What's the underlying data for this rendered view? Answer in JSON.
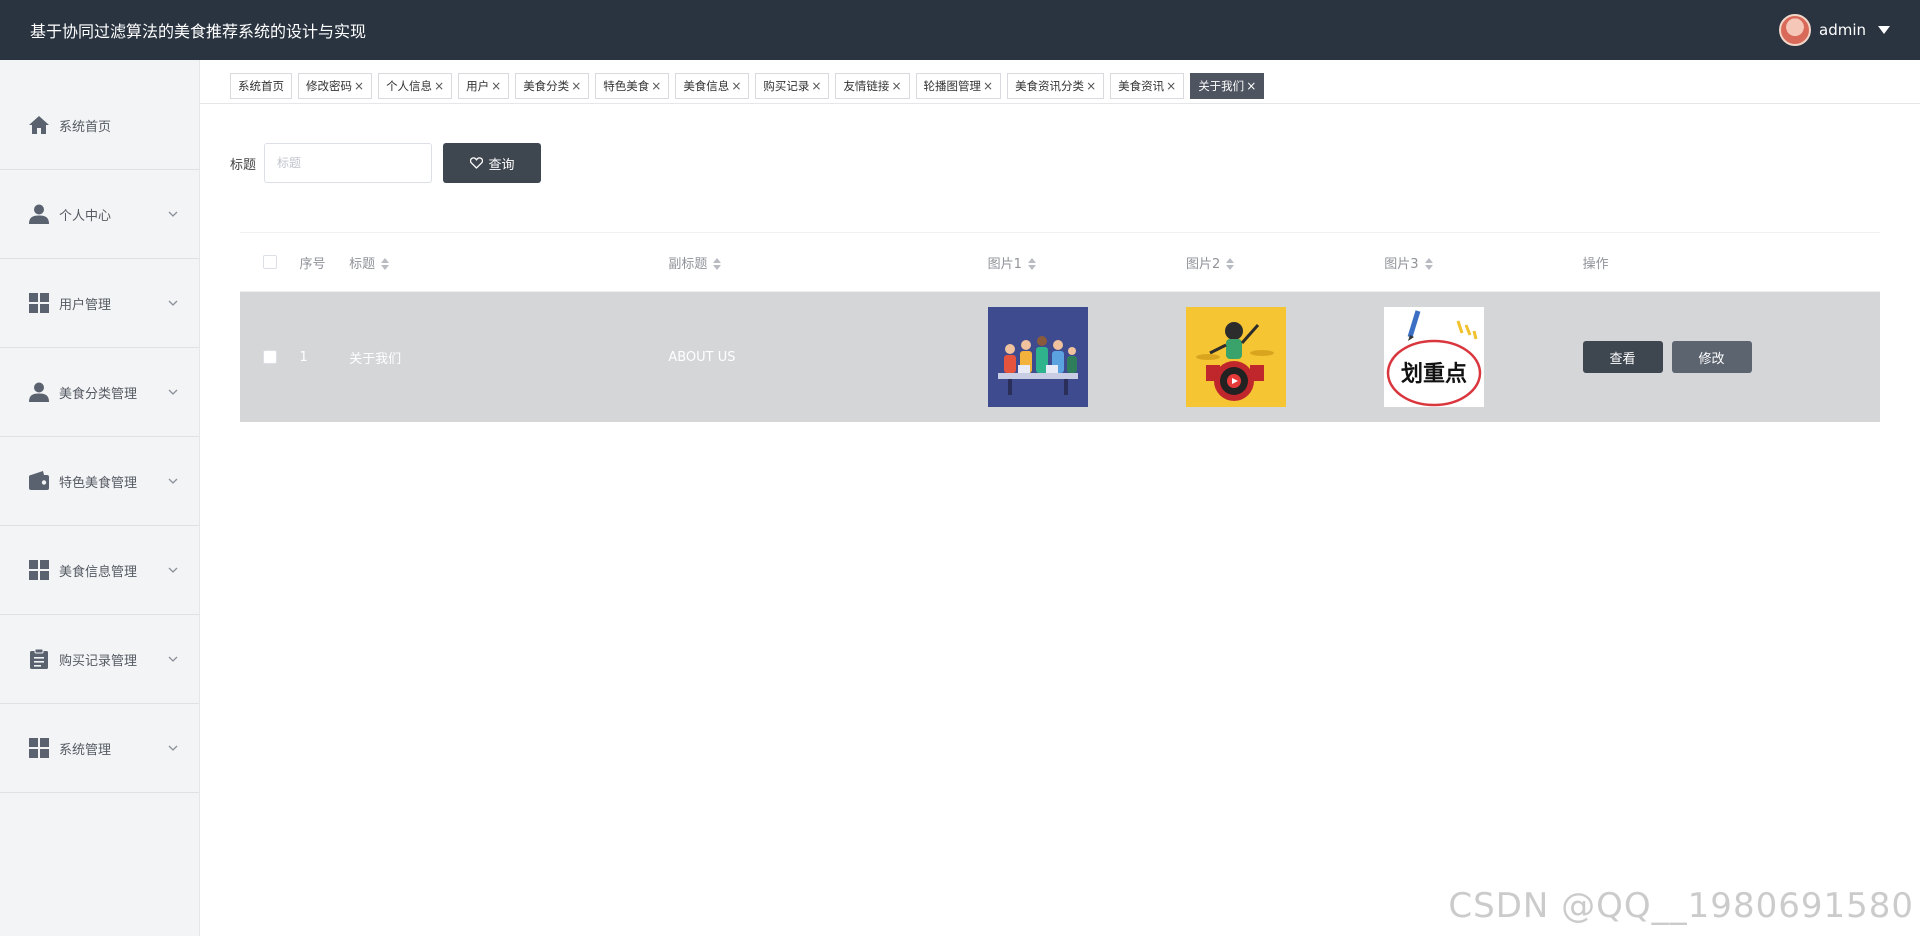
{
  "header": {
    "title": "基于协同过滤算法的美食推荐系统的设计与实现",
    "username": "admin"
  },
  "sidebar": {
    "items": [
      {
        "label": "系统首页",
        "icon": "home-icon",
        "expandable": false
      },
      {
        "label": "个人中心",
        "icon": "person-icon",
        "expandable": true
      },
      {
        "label": "用户管理",
        "icon": "grid-icon",
        "expandable": true
      },
      {
        "label": "美食分类管理",
        "icon": "person-icon",
        "expandable": true
      },
      {
        "label": "特色美食管理",
        "icon": "wallet-icon",
        "expandable": true
      },
      {
        "label": "美食信息管理",
        "icon": "grid-icon",
        "expandable": true
      },
      {
        "label": "购买记录管理",
        "icon": "clipboard-icon",
        "expandable": true
      },
      {
        "label": "系统管理",
        "icon": "grid-icon",
        "expandable": true
      }
    ]
  },
  "tabs": [
    {
      "label": "系统首页",
      "closable": false
    },
    {
      "label": "修改密码",
      "closable": true
    },
    {
      "label": "个人信息",
      "closable": true
    },
    {
      "label": "用户",
      "closable": true
    },
    {
      "label": "美食分类",
      "closable": true
    },
    {
      "label": "特色美食",
      "closable": true
    },
    {
      "label": "美食信息",
      "closable": true
    },
    {
      "label": "购买记录",
      "closable": true
    },
    {
      "label": "友情链接",
      "closable": true
    },
    {
      "label": "轮播图管理",
      "closable": true
    },
    {
      "label": "美食资讯分类",
      "closable": true
    },
    {
      "label": "美食资讯",
      "closable": true
    },
    {
      "label": "关于我们",
      "closable": true,
      "active": true
    }
  ],
  "search": {
    "label": "标题",
    "placeholder": "标题",
    "value": "",
    "button": "查询"
  },
  "table": {
    "headers": {
      "index": "序号",
      "title": "标题",
      "subtitle": "副标题",
      "img1": "图片1",
      "img2": "图片2",
      "img3": "图片3",
      "ops": "操作"
    },
    "rows": [
      {
        "index": "1",
        "title": "关于我们",
        "subtitle": "ABOUT US",
        "img3_text": "划重点",
        "view": "查看",
        "edit": "修改"
      }
    ]
  },
  "watermark": "CSDN @QQ__1980691580",
  "colors": {
    "header_bg": "#2a3440",
    "sidebar_bg": "#f3f4f6",
    "button_dark": "#3e4650",
    "row_highlight": "#d5d6d8"
  }
}
